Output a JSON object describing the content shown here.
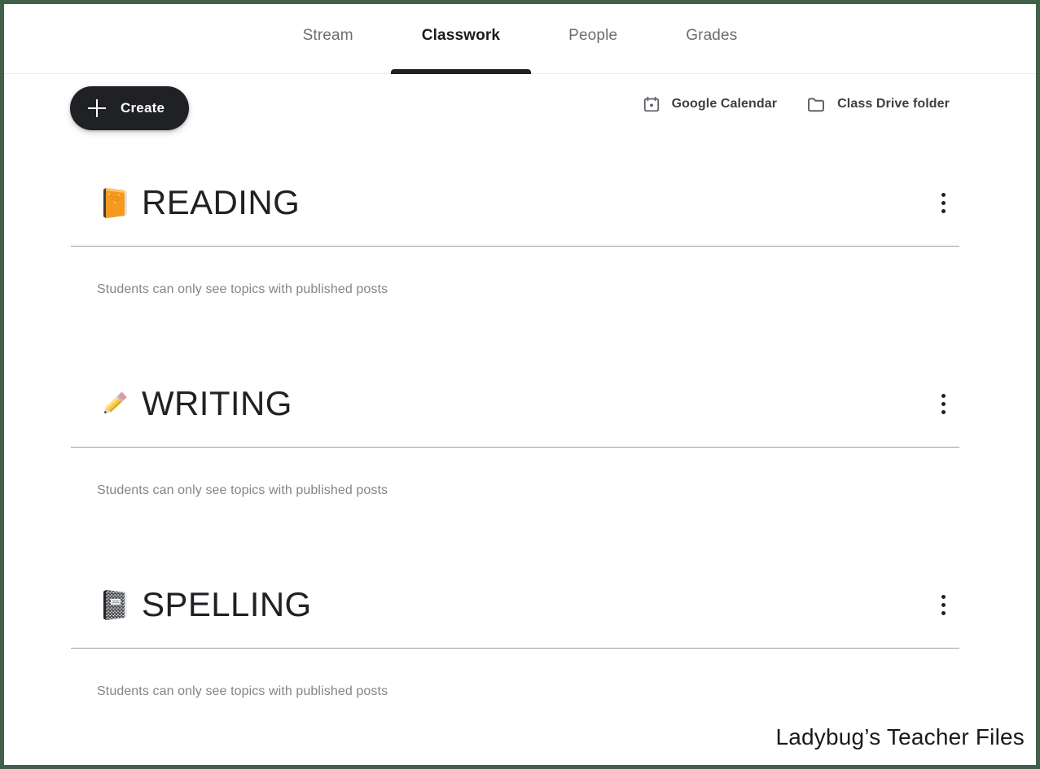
{
  "window": {
    "border_color": "#41604a",
    "background": "#ffffff"
  },
  "tabs": [
    {
      "label": "Stream",
      "active": false
    },
    {
      "label": "Classwork",
      "active": true
    },
    {
      "label": "People",
      "active": false
    },
    {
      "label": "Grades",
      "active": false
    }
  ],
  "toolbar": {
    "create_label": "Create",
    "create_icon": "plus-icon",
    "links": [
      {
        "label": "Google Calendar",
        "icon": "calendar-icon"
      },
      {
        "label": "Class Drive folder",
        "icon": "folder-icon"
      }
    ]
  },
  "topics": [
    {
      "title": "READING",
      "emoji": "orange-book-emoji",
      "note": "Students can only see topics with published posts",
      "menu_icon": "more-vert-icon"
    },
    {
      "title": "WRITING",
      "emoji": "pencil-emoji",
      "note": "Students can only see topics with published posts",
      "menu_icon": "more-vert-icon"
    },
    {
      "title": "SPELLING",
      "emoji": "notebook-emoji",
      "note": "Students can only see topics with published posts",
      "menu_icon": "more-vert-icon"
    }
  ],
  "watermark": {
    "text": "Ladybug’s Teacher Files"
  }
}
